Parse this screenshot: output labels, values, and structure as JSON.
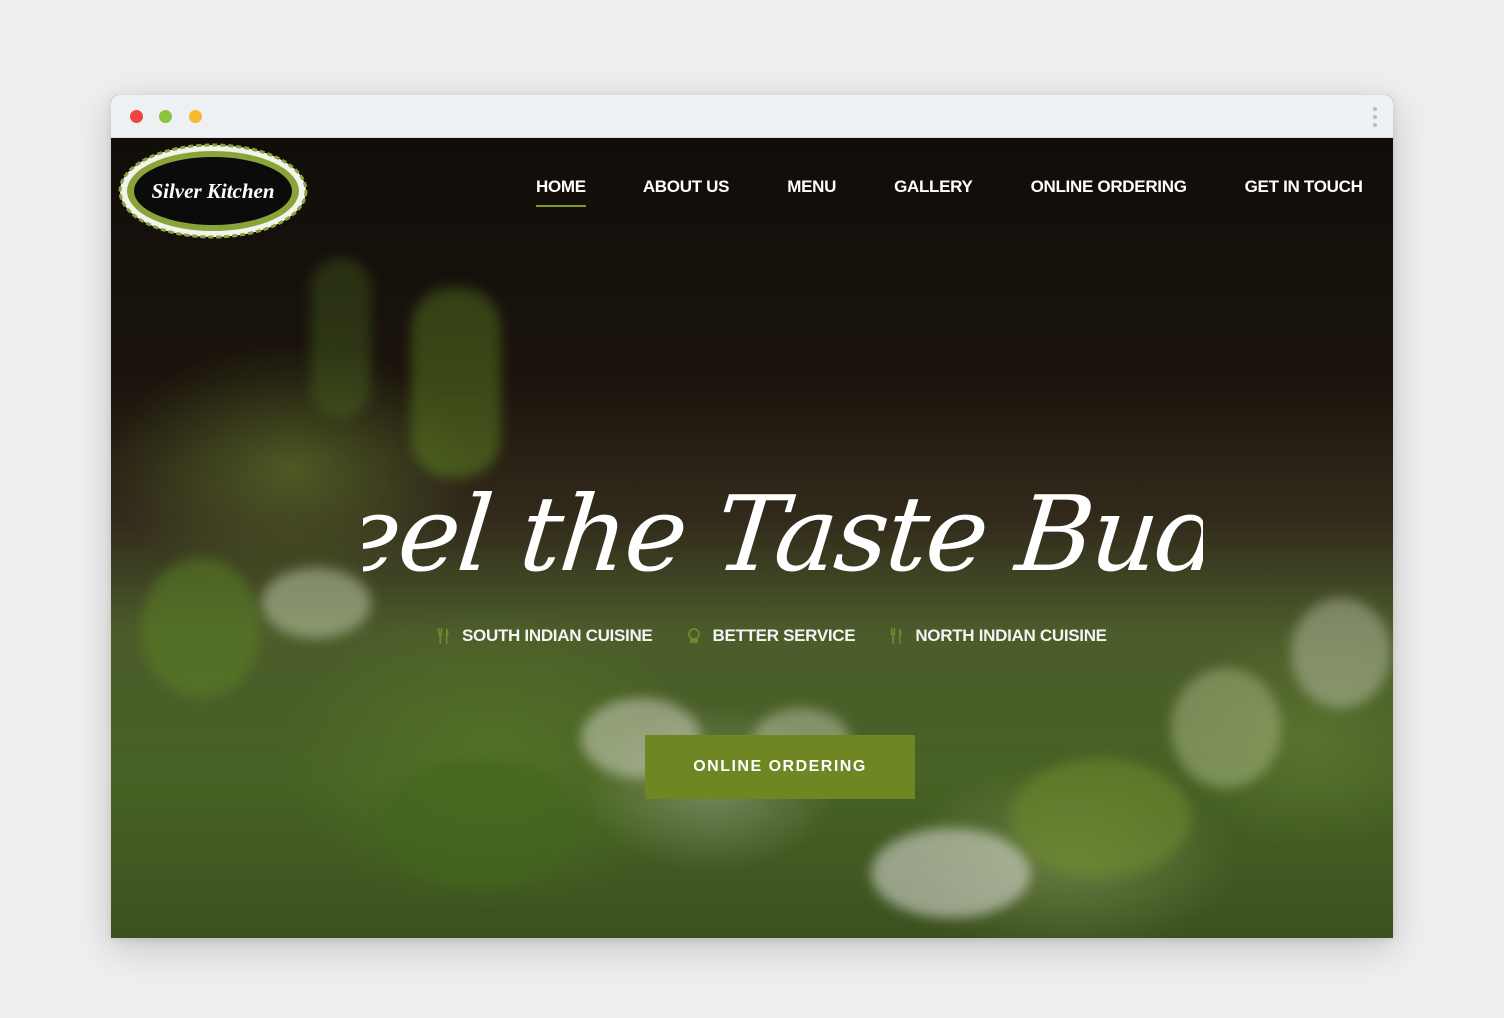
{
  "window": {
    "controls": [
      "close",
      "minimize",
      "maximize"
    ],
    "menu_icon": "kebab-menu-icon"
  },
  "brand": {
    "logo_text": "Silver Kitchen"
  },
  "nav": {
    "items": [
      {
        "label": "HOME",
        "active": true
      },
      {
        "label": "ABOUT US"
      },
      {
        "label": "MENU"
      },
      {
        "label": "GALLERY"
      },
      {
        "label": "ONLINE ORDERING"
      },
      {
        "label": "GET IN TOUCH"
      }
    ]
  },
  "hero": {
    "headline": "Feel the Taste Buds",
    "features": [
      {
        "icon": "fork-knife-icon",
        "label": "SOUTH INDIAN CUISINE"
      },
      {
        "icon": "chef-hat-icon",
        "label": "BETTER SERVICE"
      },
      {
        "icon": "fork-knife-icon",
        "label": "NORTH INDIAN CUISINE"
      }
    ],
    "cta_label": "ONLINE ORDERING"
  },
  "colors": {
    "accent": "#6e8723",
    "nav_underline": "#7d9a2a",
    "logo_ring": "#8aa43a"
  }
}
